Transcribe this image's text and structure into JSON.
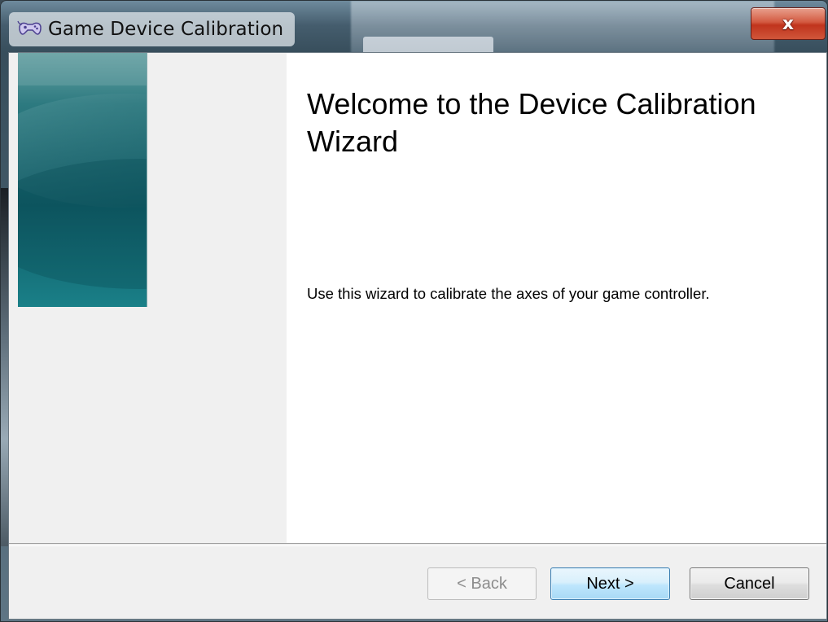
{
  "window": {
    "title": "Game Device Calibration",
    "close_label": "x"
  },
  "welcome": {
    "heading": "Welcome to the Device Calibration Wizard",
    "description": "Use this wizard to calibrate the axes of your game controller."
  },
  "buttons": {
    "back_label": "< Back",
    "back_enabled": false,
    "next_label": "Next >",
    "cancel_label": "Cancel"
  },
  "colors": {
    "banner": "#1e6a72",
    "close_red": "#c0341d",
    "next_accent": "#3c7fb1"
  },
  "icons": {
    "app": "game-controller-icon"
  }
}
